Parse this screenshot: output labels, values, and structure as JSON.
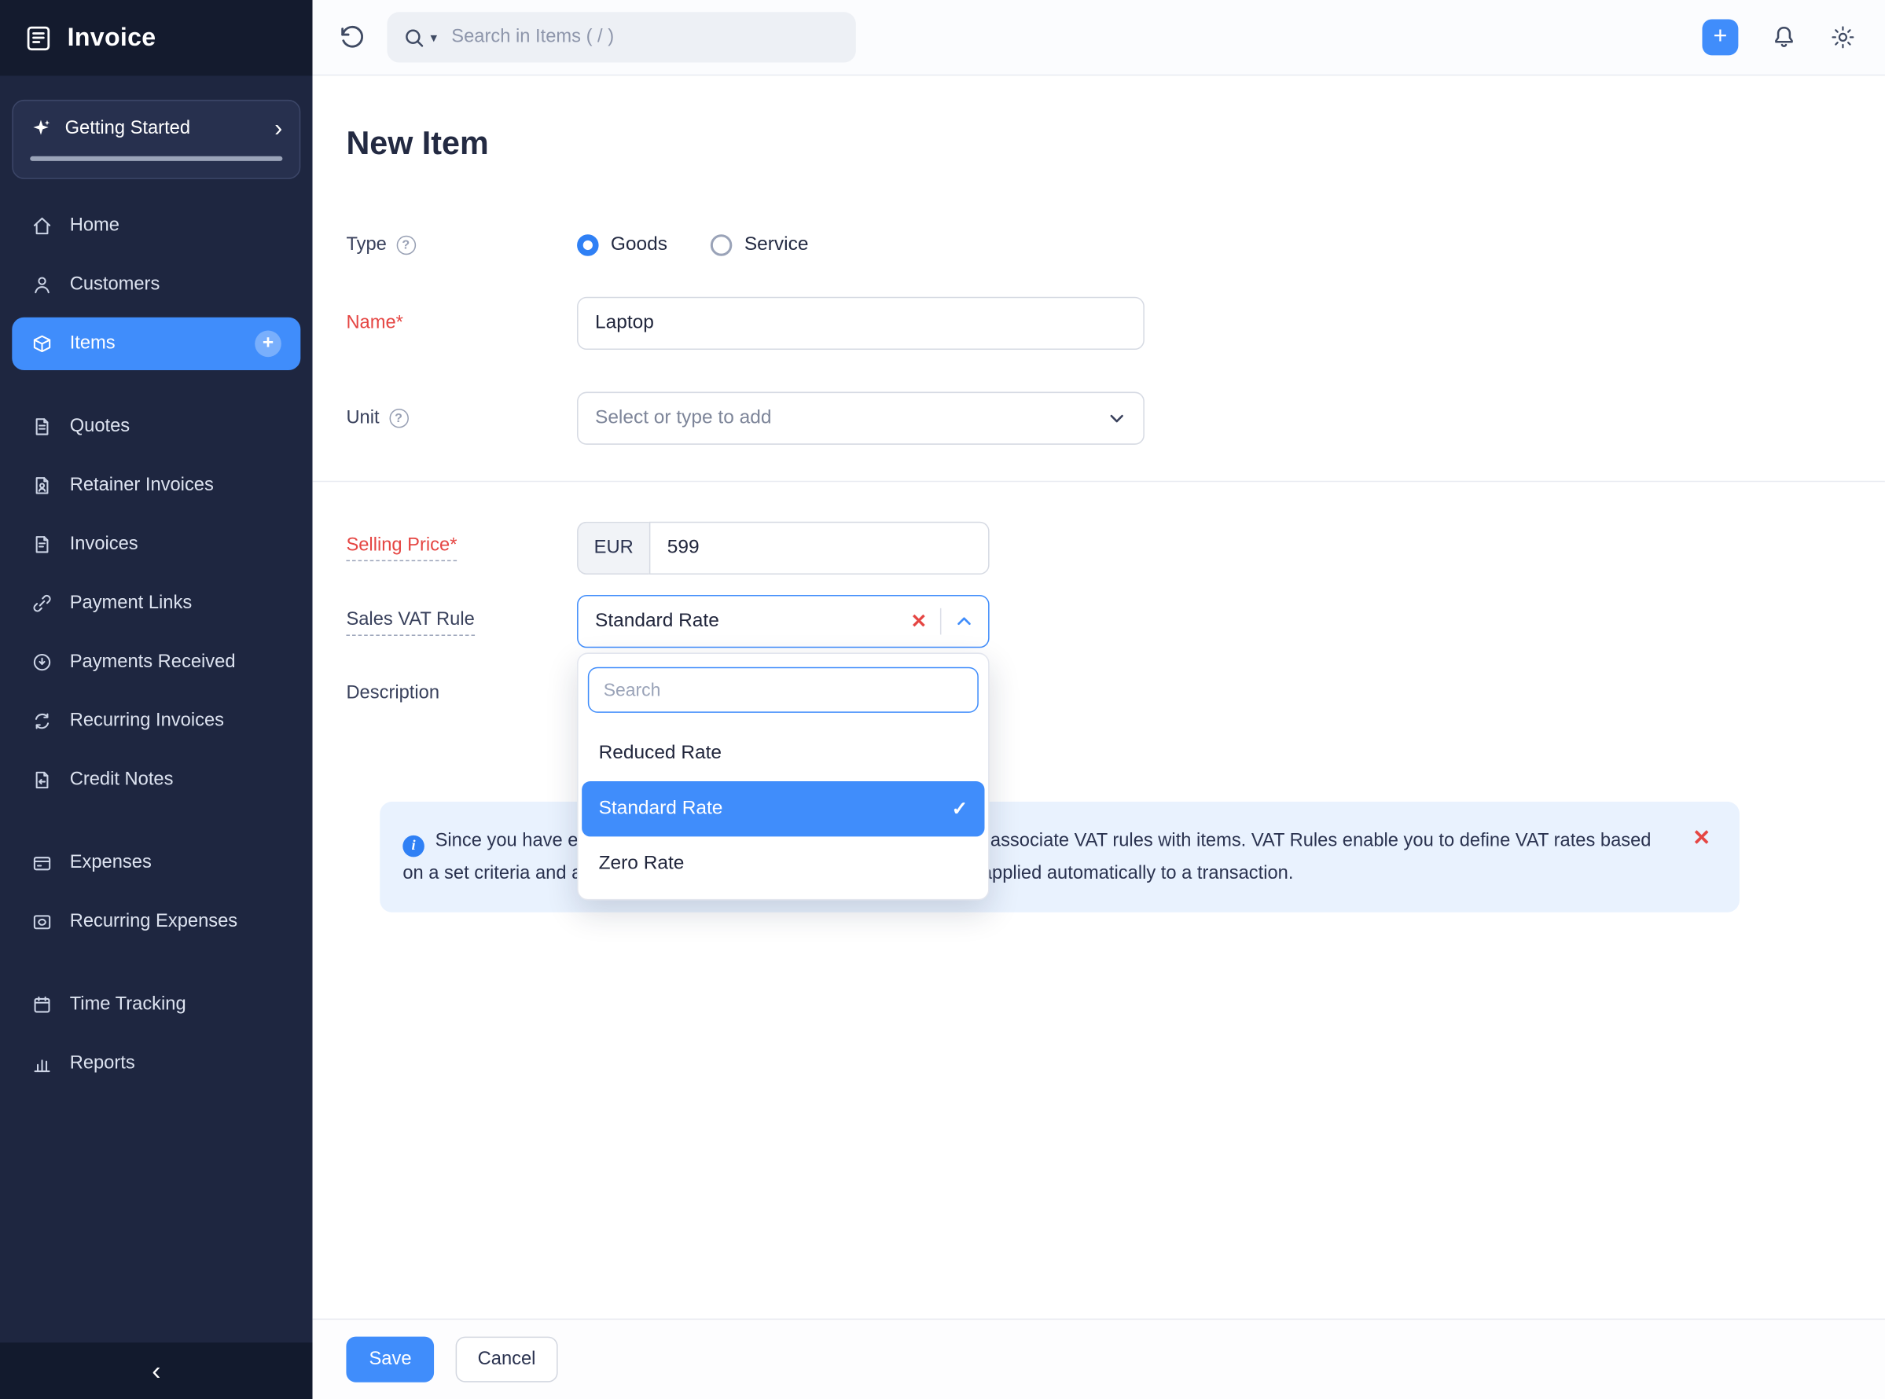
{
  "colors": {
    "accent": "#408dfb",
    "danger": "#e54643",
    "sidebar_bg": "#1e2640",
    "banner_bg": "#e9f2fe"
  },
  "app": {
    "name": "Invoice"
  },
  "topbar": {
    "search_placeholder": "Search in Items ( / )"
  },
  "sidebar": {
    "getting_started": {
      "label": "Getting Started"
    },
    "items": [
      {
        "label": "Home"
      },
      {
        "label": "Customers"
      },
      {
        "label": "Items",
        "active": true
      },
      {
        "label": "Quotes"
      },
      {
        "label": "Retainer Invoices"
      },
      {
        "label": "Invoices"
      },
      {
        "label": "Payment Links"
      },
      {
        "label": "Payments Received"
      },
      {
        "label": "Recurring Invoices"
      },
      {
        "label": "Credit Notes"
      },
      {
        "label": "Expenses"
      },
      {
        "label": "Recurring Expenses"
      },
      {
        "label": "Time Tracking"
      },
      {
        "label": "Reports"
      }
    ]
  },
  "page": {
    "title": "New Item"
  },
  "form": {
    "type": {
      "label": "Type",
      "options": [
        {
          "label": "Goods",
          "selected": true
        },
        {
          "label": "Service",
          "selected": false
        }
      ]
    },
    "name": {
      "label": "Name*",
      "value": "Laptop"
    },
    "unit": {
      "label": "Unit",
      "placeholder": "Select or type to add"
    },
    "selling_price": {
      "label": "Selling Price*",
      "currency": "EUR",
      "value": "599"
    },
    "vat": {
      "label": "Sales VAT Rule",
      "value": "Standard Rate"
    },
    "description": {
      "label": "Description"
    }
  },
  "vat_dropdown": {
    "search_placeholder": "Search",
    "options": [
      {
        "label": "Reduced Rate",
        "selected": false
      },
      {
        "label": "Standard Rate",
        "selected": true
      },
      {
        "label": "Zero Rate",
        "selected": false
      }
    ]
  },
  "banner": {
    "text": "Since you have enabled VAT for your organisation, you will have to associate VAT rules with items. VAT Rules enable you to define VAT rates based on a set criteria and associate it with an item so that VAT rates can be applied automatically to a transaction."
  },
  "actions": {
    "save": "Save",
    "cancel": "Cancel"
  },
  "icons": {
    "plus": "+",
    "close": "✕",
    "check": "✓",
    "chevron_right": "›",
    "collapse": "‹",
    "question": "?",
    "info": "i",
    "chevron_down_small": "▾"
  }
}
